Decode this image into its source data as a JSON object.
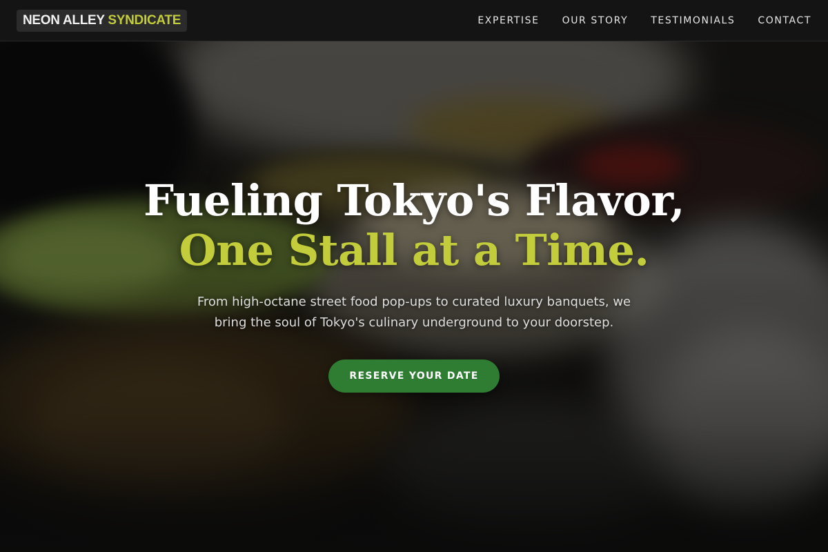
{
  "brand": {
    "name_part1": "NEON ALLEY",
    "name_part2": "SYNDICATE"
  },
  "nav": {
    "items": [
      {
        "label": "EXPERTISE"
      },
      {
        "label": "OUR STORY"
      },
      {
        "label": "TESTIMONIALS"
      },
      {
        "label": "CONTACT"
      }
    ]
  },
  "hero": {
    "headline_line1": "Fueling Tokyo's Flavor,",
    "headline_line2": "One Stall at a Time.",
    "subtitle": "From high-octane street food pop-ups to curated luxury banquets, we bring the soul of Tokyo's culinary underground to your doorstep.",
    "cta_label": "RESERVE YOUR DATE"
  },
  "colors": {
    "accent": "#c3cc3a",
    "cta_background": "#2e7d32",
    "navbar_background": "#141414"
  }
}
